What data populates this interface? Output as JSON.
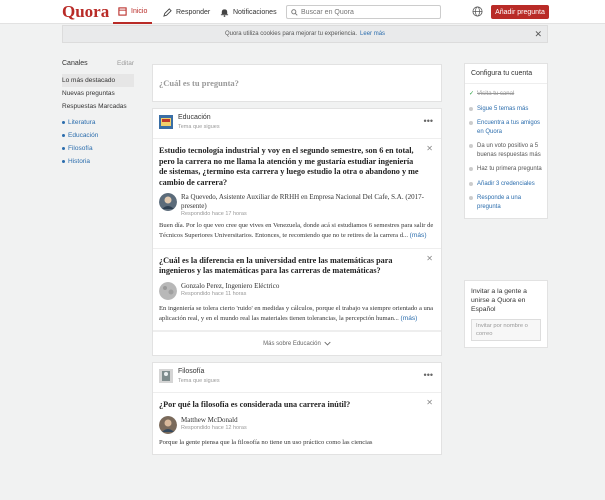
{
  "header": {
    "logo": "Quora",
    "nav": {
      "home": "Inicio",
      "answer": "Responder",
      "notifications": "Notificaciones"
    },
    "search_placeholder": "Buscar en Quora",
    "add_question": "Añadir pregunta"
  },
  "cookie_banner": {
    "text": "Quora utiliza cookies para mejorar tu experiencia.",
    "more": "Leer más"
  },
  "sidebar": {
    "title": "Canales",
    "edit": "Editar",
    "items": [
      "Lo más destacado",
      "Nuevas preguntas",
      "Respuestas Marcadas"
    ],
    "topics": [
      "Literatura",
      "Educación",
      "Filosofía",
      "Historia"
    ]
  },
  "feed": {
    "ask_placeholder": "¿Cuál es tu pregunta?",
    "cards": [
      {
        "topic": "Educación",
        "topic_sub": "Tema que sigues",
        "stories": [
          {
            "question": "Estudio tecnología industrial y voy en el segundo semestre, son 6 en total, pero la carrera no me llama la atención y me gustaría estudiar ingeniería de sistemas, ¿termino esta carrera y luego estudio la otra o abandono y me cambio de carrera?",
            "author": "Ra Quevedo, Asistente Auxiliar de RRHH en Empresa Nacional Del Cafe, S.A. (2017-presente)",
            "time": "Respondido hace 17 horas",
            "answer": "Buen día. Por lo que veo cree que vives en Venezuela, donde acá si estudiamos 6 semestres para salir de Técnicos Superiores Universitarios. Entonces, te recomiendo que no te retires de la carrera d...",
            "more": "(más)"
          },
          {
            "question": "¿Cuál es la diferencia en la universidad entre las matemáticas para ingenieros y las matemáticas para las carreras de matemáticas?",
            "author": "Gonzalo Perez, Ingeniero Eléctrico",
            "time": "Respondido hace 11 horas",
            "answer": "En ingeniería se tolera cierto 'ruido' en medidas y cálculos, porque el trabajo va siempre orientado a una aplicación real, y en el mundo real las materiales tienen tolerancias, la percepción human...",
            "more": "(más)"
          }
        ],
        "more_topic": "Más sobre Educación"
      },
      {
        "topic": "Filosofía",
        "topic_sub": "Tema que sigues",
        "stories": [
          {
            "question": "¿Por qué la filosofía es considerada una carrera inútil?",
            "author": "Matthew McDonald",
            "time": "Respondido hace 12 horas",
            "answer": "Porque la gente piensa que la filosofía no tiene un uso práctico como las ciencias"
          }
        ]
      }
    ]
  },
  "setup": {
    "title": "Configura tu cuenta",
    "items": [
      {
        "label": "Visita tu canal",
        "state": "done"
      },
      {
        "label": "Sigue 5 temas más",
        "state": "link"
      },
      {
        "label": "Encuentra a tus amigos en Quora",
        "state": "link"
      },
      {
        "label": "Da un voto positivo a 5 buenas respuestas más",
        "state": "grey"
      },
      {
        "label": "Haz tu primera pregunta",
        "state": "grey"
      },
      {
        "label": "Añadir 3 credenciales",
        "state": "link"
      },
      {
        "label": "Responde a una pregunta",
        "state": "link"
      }
    ]
  },
  "invite": {
    "title": "Invitar a la gente a unirse a Quora en Español",
    "placeholder": "Invitar por nombre o correo"
  },
  "colors": {
    "brand": "#b92b27",
    "link": "#2b6dad",
    "background": "#f1f2f2"
  }
}
